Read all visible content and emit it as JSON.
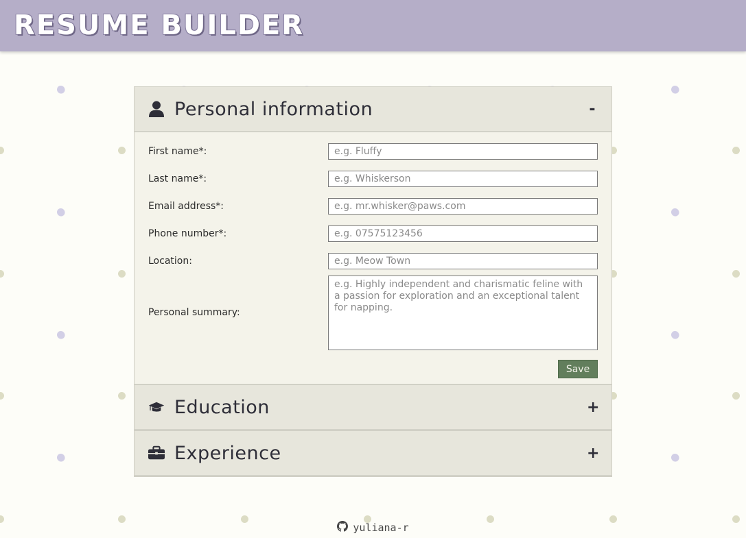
{
  "app": {
    "title": "RESUME BUILDER"
  },
  "sections": {
    "personal": {
      "title": "Personal information",
      "toggle": "-",
      "icon": "user-icon",
      "fields": {
        "first_name": {
          "label": "First name*:",
          "placeholder": "e.g. Fluffy"
        },
        "last_name": {
          "label": "Last name*:",
          "placeholder": "e.g. Whiskerson"
        },
        "email": {
          "label": "Email address*:",
          "placeholder": "e.g. mr.whisker@paws.com"
        },
        "phone": {
          "label": "Phone number*:",
          "placeholder": "e.g. 07575123456"
        },
        "location": {
          "label": "Location:",
          "placeholder": "e.g. Meow Town"
        },
        "summary": {
          "label": "Personal summary:",
          "placeholder": "e.g. Highly independent and charismatic feline with a passion for exploration and an exceptional talent for napping."
        }
      },
      "save_label": "Save"
    },
    "education": {
      "title": "Education",
      "toggle": "+",
      "icon": "graduation-cap-icon"
    },
    "experience": {
      "title": "Experience",
      "toggle": "+",
      "icon": "briefcase-icon"
    }
  },
  "footer": {
    "username": "yuliana-r",
    "icon": "github-icon"
  },
  "colors": {
    "header": "#b5aec8",
    "panel": "#e7e6dc",
    "form_bg": "#f4f3ea",
    "save_button": "#627e5c",
    "page_bg": "#fdfdf8"
  }
}
